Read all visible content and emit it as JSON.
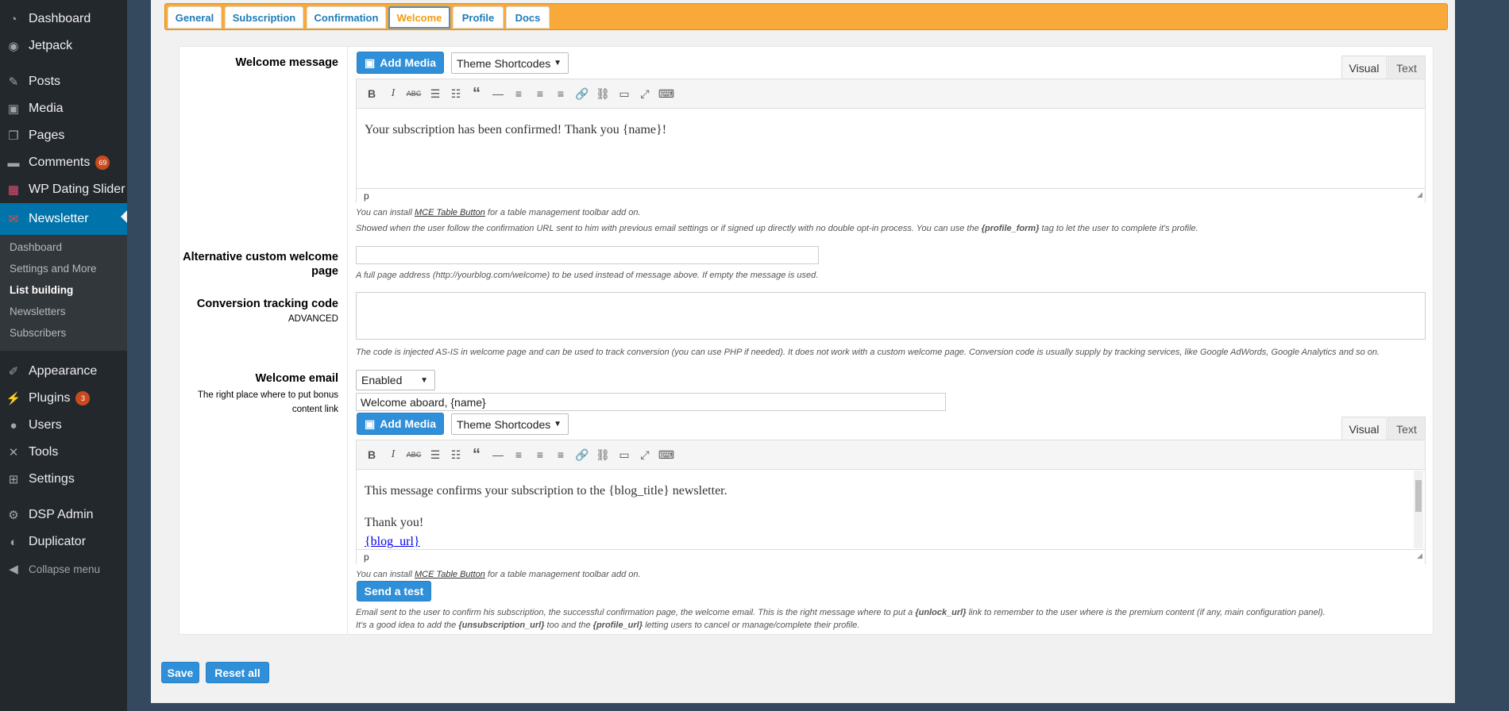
{
  "sidebar": {
    "items": [
      {
        "label": "Dashboard",
        "icon": "dashboard-icon"
      },
      {
        "label": "Jetpack",
        "icon": "jetpack-icon"
      },
      {
        "label": "Posts",
        "icon": "pin-icon"
      },
      {
        "label": "Media",
        "icon": "media-icon"
      },
      {
        "label": "Pages",
        "icon": "pages-icon"
      },
      {
        "label": "Comments",
        "icon": "comment-icon",
        "badge": "69"
      },
      {
        "label": "WP Dating Slider",
        "icon": "slider-icon"
      },
      {
        "label": "Newsletter",
        "icon": "newsletter-icon"
      },
      {
        "label": "Appearance",
        "icon": "brush-icon"
      },
      {
        "label": "Plugins",
        "icon": "plug-icon",
        "badge": "3"
      },
      {
        "label": "Users",
        "icon": "user-icon"
      },
      {
        "label": "Tools",
        "icon": "wrench-icon"
      },
      {
        "label": "Settings",
        "icon": "settings-icon"
      },
      {
        "label": "DSP Admin",
        "icon": "gear-icon"
      },
      {
        "label": "Duplicator",
        "icon": "duplicate-icon"
      },
      {
        "label": "Collapse menu",
        "icon": "collapse-icon"
      }
    ],
    "submenu": [
      "Dashboard",
      "Settings and More",
      "List building",
      "Newsletters",
      "Subscribers"
    ]
  },
  "tabs": [
    "General",
    "Subscription",
    "Confirmation",
    "Welcome",
    "Profile",
    "Docs"
  ],
  "welcome_message": {
    "label": "Welcome message",
    "add_media": "Add Media",
    "shortcodes": "Theme Shortcodes",
    "visual": "Visual",
    "text": "Text",
    "content": "Your subscription has been confirmed! Thank you {name}!",
    "path": "p",
    "help1_pre": "You can install ",
    "help1_link": "MCE Table Button",
    "help1_post": " for a table management toolbar add on.",
    "help2_pre": "Showed when the user follow the confirmation URL sent to him with previous email settings or if signed up directly with no double opt-in process. You can use the ",
    "help2_bold": "{profile_form}",
    "help2_post": " tag to let the user to complete it's profile."
  },
  "alt_page": {
    "label": "Alternative custom welcome page",
    "value": "",
    "help": "A full page address (http://yourblog.com/welcome) to be used instead of message above. If empty the message is used."
  },
  "conversion": {
    "label": "Conversion tracking code",
    "sublabel": "ADVANCED",
    "value": "",
    "help": "The code is injected AS-IS in welcome page and can be used to track conversion (you can use PHP if needed). It does not work with a custom welcome page. Conversion code is usually supply by tracking services, like Google AdWords, Google Analytics and so on."
  },
  "welcome_email": {
    "label": "Welcome email",
    "sublabel": "The right place where to put bonus content link",
    "enabled": "Enabled",
    "subject": "Welcome aboard, {name}",
    "add_media": "Add Media",
    "shortcodes": "Theme Shortcodes",
    "visual": "Visual",
    "text": "Text",
    "line1": "This message confirms your subscription to the {blog_title} newsletter.",
    "line2": "Thank you!",
    "line3": "{blog_url}",
    "path": "p",
    "help1_pre": "You can install ",
    "help1_link": "MCE Table Button",
    "help1_post": " for a table management toolbar add on.",
    "send_test": "Send a test",
    "help2_pre": "Email sent to the user to confirm his subscription, the successful confirmation page, the welcome email. This is the right message where to put a ",
    "help2_bold": "{unlock_url}",
    "help2_post": " link to remember to the user where is the premium content (if any, main configuration panel).",
    "help3_pre": "It's a good idea to add the ",
    "help3_bold1": "{unsubscription_url}",
    "help3_mid": " too and the ",
    "help3_bold2": "{profile_url}",
    "help3_post": " letting users to cancel or manage/complete their profile."
  },
  "footer": {
    "save": "Save",
    "reset": "Reset all"
  },
  "colors": {
    "accent": "#0073aa",
    "tabbar": "#f9a93a",
    "button": "#2f8fd8",
    "badge": "#ca4a1f"
  }
}
